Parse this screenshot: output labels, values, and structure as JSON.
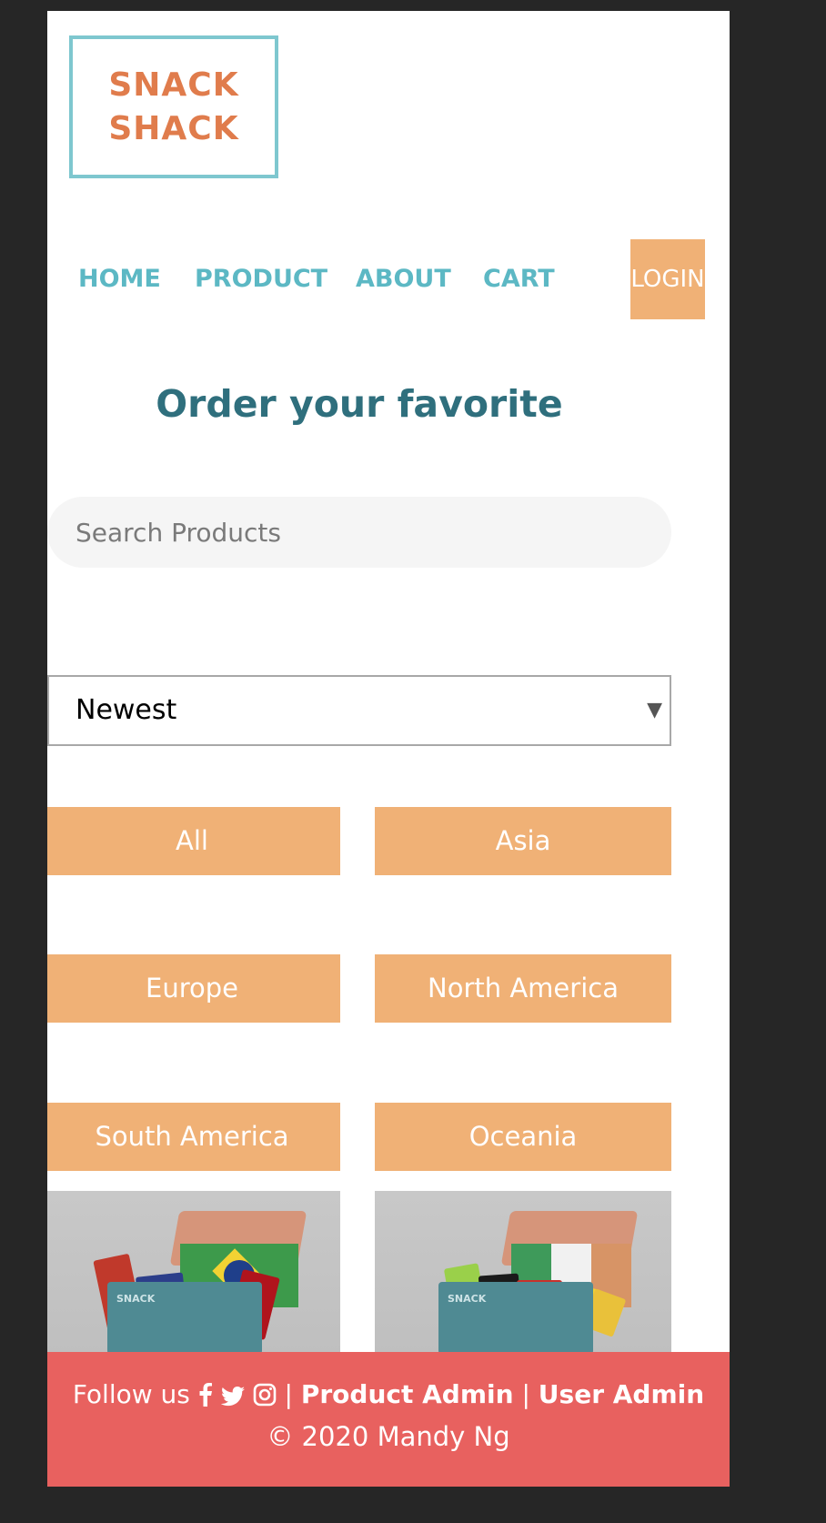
{
  "logo": {
    "line1": "SNACK",
    "line2": "SHACK"
  },
  "nav": {
    "home": "HOME",
    "product": "PRODUCT",
    "about": "ABOUT",
    "cart": "CART",
    "login": "LOGIN"
  },
  "headline": "Order your favorite",
  "search": {
    "placeholder": "Search Products",
    "value": ""
  },
  "sort": {
    "selected": "Newest"
  },
  "filters": [
    "All",
    "Asia",
    "Europe",
    "North America",
    "South America",
    "Oceania"
  ],
  "footer": {
    "follow_label": "Follow us",
    "separator": "|",
    "product_admin": "Product Admin",
    "user_admin": "User Admin",
    "copyright": "© 2020 Mandy Ng"
  },
  "colors": {
    "accent": "#f0b176",
    "nav_text": "#5cb8c4",
    "headline": "#2f6f7d",
    "footer_bg": "#e8615f",
    "logo_border": "#7ec7cf",
    "logo_text": "#e07c4c"
  }
}
